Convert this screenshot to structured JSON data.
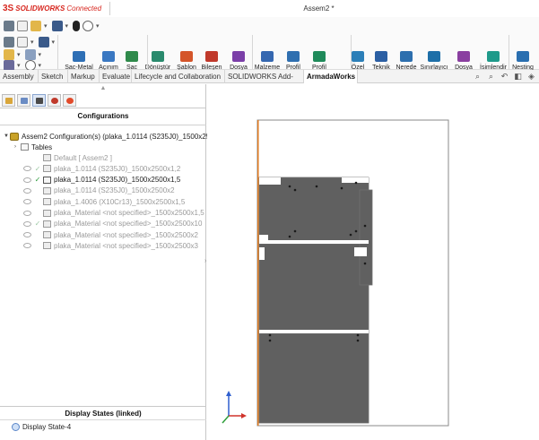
{
  "app": {
    "logo_mark": "3S",
    "logo_brand": "SOLIDWORKS",
    "logo_suffix": "Connected",
    "document_title": "Assem2 *"
  },
  "toolbar": {
    "commands": [
      {
        "id": "sac-metal",
        "label": "Sac-Metal\nDeğişkenleri",
        "icon": "sheetmetal-variables-icon",
        "color": "#2e6fb5"
      },
      {
        "id": "acinim",
        "label": "Açınım\nAl",
        "icon": "flat-pattern-icon",
        "color": "#3a78c2"
      },
      {
        "id": "sac-listesi",
        "label": "Sac\nListesi",
        "icon": "sheet-list-icon",
        "color": "#2f8a4b"
      },
      {
        "id": "donustur",
        "label": "Dönüştür",
        "icon": "convert-icon",
        "color": "#2a8a6d"
      },
      {
        "id": "sablon",
        "label": "Şablon\nDeğiştir",
        "icon": "template-icon",
        "color": "#d4552a"
      },
      {
        "id": "bilesen",
        "label": "Bileşen\nEkle",
        "icon": "add-component-icon",
        "color": "#c0392b"
      },
      {
        "id": "dosya-konumu",
        "label": "Dosya\nKonumu",
        "icon": "file-location-icon",
        "color": "#7b3fa8"
      },
      {
        "id": "malzeme",
        "label": "Malzeme\nListesi",
        "icon": "material-list-icon",
        "color": "#3567b0"
      },
      {
        "id": "profil-listesi",
        "label": "Profil\nListesi",
        "icon": "profile-list-icon",
        "color": "#2f6fb0"
      },
      {
        "id": "profil-opt",
        "label": "Profil\nOptimizasyon",
        "icon": "profile-optimization-icon",
        "color": "#1f8a5a"
      },
      {
        "id": "ozel",
        "label": "Özel\nÖzellik",
        "icon": "custom-property-icon",
        "color": "#2c7fb8"
      },
      {
        "id": "teknik",
        "label": "Teknik\nResim",
        "icon": "drawing-icon",
        "color": "#2b5fa3"
      },
      {
        "id": "nerede",
        "label": "Nerede\nKullanıldı",
        "icon": "where-used-icon",
        "color": "#2d6fae"
      },
      {
        "id": "sinirlayici",
        "label": "Sınırlayıcı\nKutu",
        "icon": "bounding-box-icon",
        "color": "#1e6fa8"
      },
      {
        "id": "dosya-tarihcesi",
        "label": "Dosya\nTarihçesi",
        "icon": "file-history-icon",
        "color": "#8a3fa0"
      },
      {
        "id": "isimlendir",
        "label": "İsimlendir",
        "icon": "rename-icon",
        "color": "#1f9a8a"
      },
      {
        "id": "nesting",
        "label": "Nesting",
        "icon": "nesting-icon",
        "color": "#2a6fb0"
      }
    ]
  },
  "tabs": [
    {
      "label": "Assembly",
      "active": false
    },
    {
      "label": "Sketch",
      "active": false
    },
    {
      "label": "Markup",
      "active": false
    },
    {
      "label": "Evaluate",
      "active": false
    },
    {
      "label": "Lifecycle and Collaboration",
      "active": false
    },
    {
      "label": "SOLIDWORKS Add-Ins",
      "active": false
    },
    {
      "label": "ArmadaWorks",
      "active": true
    }
  ],
  "panel": {
    "title": "Configurations",
    "root": "Assem2 Configuration(s)  (plaka_1.0114 (S235J0)_1500x2500x",
    "tables_label": "Tables",
    "configs": [
      {
        "label": "Default [ Assem2 ]",
        "checked": false,
        "dim": true,
        "eye": false
      },
      {
        "label": "plaka_1.0114 (S235J0)_1500x2500x1,2",
        "checked": true,
        "dim": true,
        "eye": true
      },
      {
        "label": "plaka_1.0114 (S235J0)_1500x2500x1,5",
        "checked": true,
        "dim": false,
        "eye": true
      },
      {
        "label": "plaka_1.0114 (S235J0)_1500x2500x2",
        "checked": false,
        "dim": true,
        "eye": true
      },
      {
        "label": "plaka_1.4006 (X10Cr13)_1500x2500x1,5",
        "checked": false,
        "dim": true,
        "eye": true
      },
      {
        "label": "plaka_Material <not specified>_1500x2500x1,5",
        "checked": false,
        "dim": true,
        "eye": true
      },
      {
        "label": "plaka_Material <not specified>_1500x2500x10",
        "checked": true,
        "dim": true,
        "eye": true
      },
      {
        "label": "plaka_Material <not specified>_1500x2500x2",
        "checked": false,
        "dim": true,
        "eye": true
      },
      {
        "label": "plaka_Material <not specified>_1500x2500x3",
        "checked": false,
        "dim": true,
        "eye": true
      }
    ],
    "display_states_title": "Display States (linked)",
    "display_state": "Display State-4"
  },
  "colors": {
    "sheet_fill": "#606060",
    "sheet_border": "#6e6e6e",
    "accent_edge": "#e07a1f",
    "axis_x": "#d0332b",
    "axis_y": "#2e9e3a",
    "axis_z": "#2f5fcf"
  }
}
